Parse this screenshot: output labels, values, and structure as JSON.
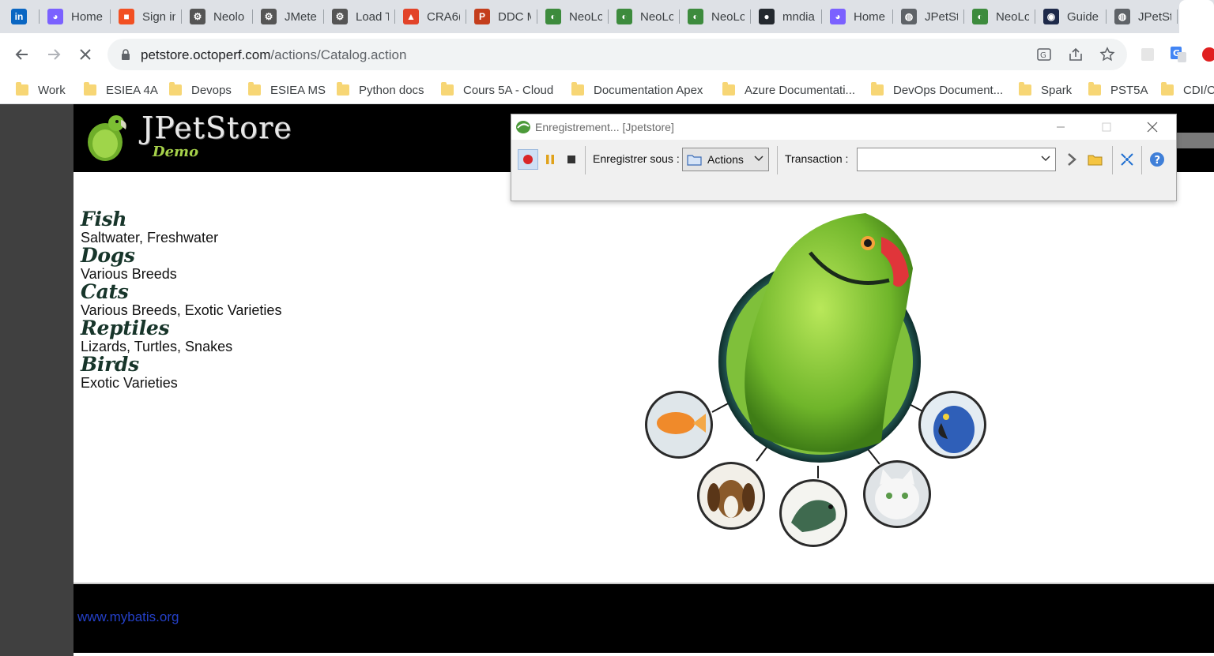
{
  "browser": {
    "tabs": [
      {
        "label": "",
        "icon": "linkedin-icon",
        "color": "#0a66c2",
        "glyph": "in"
      },
      {
        "label": "Home",
        "icon": "loop-icon",
        "color": "#7b61ff",
        "glyph": "◕"
      },
      {
        "label": "Sign in",
        "icon": "microsoft-icon",
        "color": "#f25022",
        "glyph": "■"
      },
      {
        "label": "Neolo",
        "icon": "gear-icon",
        "color": "#555555",
        "glyph": "⚙"
      },
      {
        "label": "JMete",
        "icon": "gear-icon",
        "color": "#555555",
        "glyph": "⚙"
      },
      {
        "label": "Load T",
        "icon": "gear-icon",
        "color": "#555555",
        "glyph": "⚙"
      },
      {
        "label": "CRA6(",
        "icon": "gitlab-icon",
        "color": "#e24329",
        "glyph": "▲"
      },
      {
        "label": "DDC M",
        "icon": "powerpoint-icon",
        "color": "#c43e1c",
        "glyph": "P"
      },
      {
        "label": "NeoLo",
        "icon": "neoload-icon",
        "color": "#3d8b3d",
        "glyph": "◐"
      },
      {
        "label": "NeoLo",
        "icon": "neoload-icon",
        "color": "#3d8b3d",
        "glyph": "◐"
      },
      {
        "label": "NeoLo",
        "icon": "neoload-icon",
        "color": "#3d8b3d",
        "glyph": "◐"
      },
      {
        "label": "mndia",
        "icon": "github-icon",
        "color": "#24292f",
        "glyph": "●"
      },
      {
        "label": "Home",
        "icon": "loop-icon",
        "color": "#7b61ff",
        "glyph": "◕"
      },
      {
        "label": "JPetSt",
        "icon": "globe-icon",
        "color": "#5f6368",
        "glyph": "◍"
      },
      {
        "label": "NeoLo",
        "icon": "neoload-icon",
        "color": "#3d8b3d",
        "glyph": "◐"
      },
      {
        "label": "Guide",
        "icon": "doc-icon",
        "color": "#1e2a4a",
        "glyph": "◉"
      },
      {
        "label": "JPetSt",
        "icon": "globe-icon",
        "color": "#5f6368",
        "glyph": "◍"
      }
    ],
    "url_host": "petstore.octoperf.com",
    "url_path": "/actions/Catalog.action",
    "bookmarks": [
      "Work",
      "ESIEA 4A",
      "Devops",
      "ESIEA MS",
      "Python docs",
      "Cours 5A - Cloud",
      "Documentation Apex",
      "Azure Documentati...",
      "DevOps Document...",
      "Spark",
      "PST5A",
      "CDI/C"
    ]
  },
  "store": {
    "logo_title": "JPetStore",
    "logo_subtitle": "Demo",
    "categories": [
      {
        "name": "Fish",
        "desc": "Saltwater, Freshwater"
      },
      {
        "name": "Dogs",
        "desc": "Various Breeds"
      },
      {
        "name": "Cats",
        "desc": "Various Breeds, Exotic Varieties"
      },
      {
        "name": "Reptiles",
        "desc": "Lizards, Turtles, Snakes"
      },
      {
        "name": "Birds",
        "desc": "Exotic Varieties"
      }
    ],
    "footer_link": "www.mybatis.org"
  },
  "recorder": {
    "title": "Enregistrement... [Jpetstore]",
    "record_as_label": "Enregistrer sous :",
    "record_as_value": "Actions",
    "transaction_label": "Transaction :",
    "transaction_value": ""
  },
  "colors": {
    "accent_green": "#a6d14a",
    "heading_dark_green": "#17352a",
    "link_blue": "#2440c8"
  }
}
